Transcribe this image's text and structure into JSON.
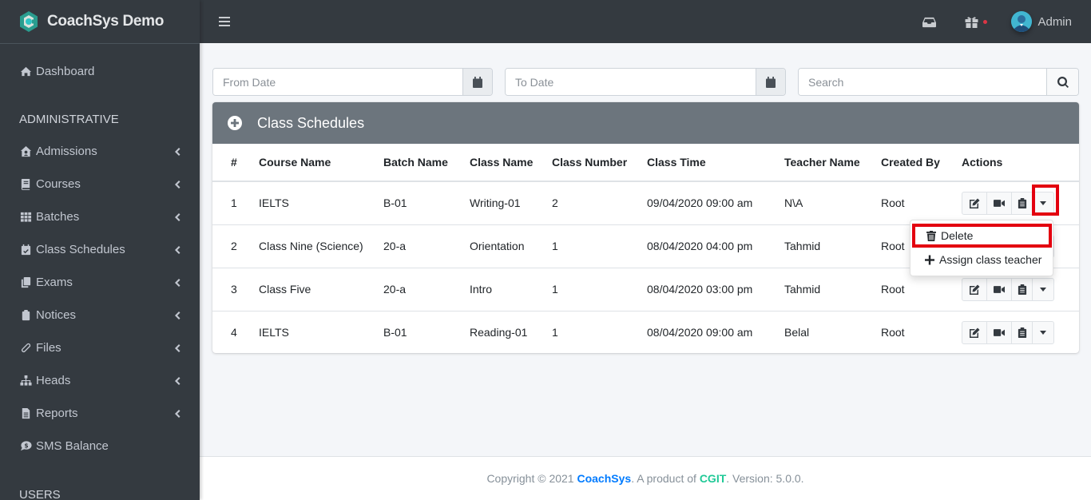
{
  "app": {
    "brand": "CoachSys Demo"
  },
  "topbar": {
    "user_name": "Admin"
  },
  "sidebar": {
    "dashboard": "Dashboard",
    "section_admin": "ADMINISTRATIVE",
    "items": [
      {
        "label": "Admissions",
        "icon": "house-user-icon"
      },
      {
        "label": "Courses",
        "icon": "book-icon"
      },
      {
        "label": "Batches",
        "icon": "th-grid-icon"
      },
      {
        "label": "Class Schedules",
        "icon": "calendar-check-icon"
      },
      {
        "label": "Exams",
        "icon": "copy-icon"
      },
      {
        "label": "Notices",
        "icon": "clipboard-icon"
      },
      {
        "label": "Files",
        "icon": "paperclip-icon"
      },
      {
        "label": "Heads",
        "icon": "sitemap-icon"
      },
      {
        "label": "Reports",
        "icon": "file-alt-icon"
      }
    ],
    "sms_balance": "SMS Balance",
    "section_users": "USERS"
  },
  "filters": {
    "from_date_placeholder": "From Date",
    "from_date_value": "",
    "to_date_placeholder": "To Date",
    "to_date_value": "",
    "search_placeholder": "Search",
    "search_value": ""
  },
  "card": {
    "title": "Class Schedules"
  },
  "table": {
    "columns": [
      "#",
      "Course Name",
      "Batch Name",
      "Class Name",
      "Class Number",
      "Class Time",
      "Teacher Name",
      "Created By",
      "Actions"
    ],
    "rows": [
      {
        "no": "1",
        "course": "IELTS",
        "batch": "B-01",
        "class_name": "Writing-01",
        "class_number": "2",
        "time": "09/04/2020 09:00 am",
        "teacher": "N\\A",
        "created_by": "Root"
      },
      {
        "no": "2",
        "course": "Class Nine (Science)",
        "batch": "20-a",
        "class_name": "Orientation",
        "class_number": "1",
        "time": "08/04/2020 04:00 pm",
        "teacher": "Tahmid",
        "created_by": "Root"
      },
      {
        "no": "3",
        "course": "Class Five",
        "batch": "20-a",
        "class_name": "Intro",
        "class_number": "1",
        "time": "08/04/2020 03:00 pm",
        "teacher": "Tahmid",
        "created_by": "Root"
      },
      {
        "no": "4",
        "course": "IELTS",
        "batch": "B-01",
        "class_name": "Reading-01",
        "class_number": "1",
        "time": "08/04/2020 09:00 am",
        "teacher": "Belal",
        "created_by": "Root"
      }
    ]
  },
  "dropdown": {
    "delete": "Delete",
    "assign": "Assign class teacher"
  },
  "footer": {
    "prefix": "Copyright © 2021 ",
    "brand": "CoachSys",
    "middle": ". A product of ",
    "company": "CGIT",
    "suffix": ". Version: 5.0.0."
  },
  "colors": {
    "sidebar_bg": "#343a40",
    "card_header_bg": "#6c757d",
    "highlight": "#e3000f",
    "link_blue": "#007bff",
    "link_green": "#20c997",
    "notification_dot": "#dc3545"
  }
}
